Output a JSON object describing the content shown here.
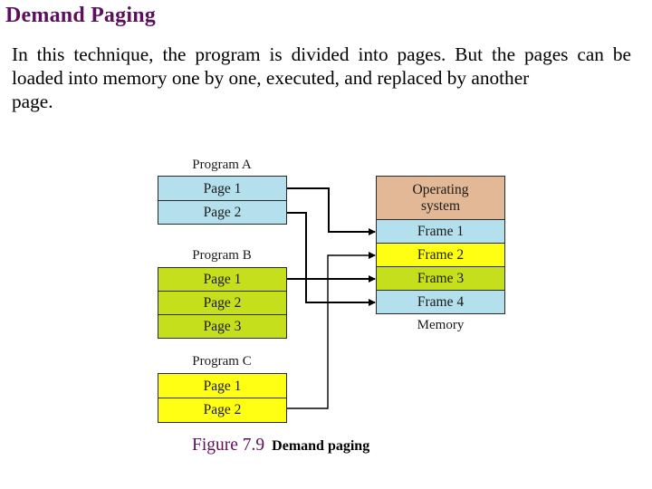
{
  "slide": {
    "title": "Demand Paging",
    "paragraph_main": "In this technique, the program is divided into pages. But the pages can be loaded into memory one by one, executed, and replaced by another",
    "paragraph_last": "page."
  },
  "colors": {
    "title": "#5c0f5c",
    "program_a": "#b3e0ec",
    "program_b": "#c5df1c",
    "program_c": "#ffff14",
    "operating_system": "#e3b896",
    "line": "#000000"
  },
  "diagram": {
    "programs": [
      {
        "name": "Program A",
        "pages": [
          "Page 1",
          "Page 2"
        ]
      },
      {
        "name": "Program B",
        "pages": [
          "Page 1",
          "Page 2",
          "Page 3"
        ]
      },
      {
        "name": "Program C",
        "pages": [
          "Page 1",
          "Page 2"
        ]
      }
    ],
    "memory": {
      "label": "Memory",
      "os_label": "Operating system",
      "frames": [
        "Frame 1",
        "Frame 2",
        "Frame 3",
        "Frame 4"
      ]
    },
    "mappings": [
      {
        "program": "Program A",
        "page": "Page 1",
        "frame": "Frame 1"
      },
      {
        "program": "Program C",
        "page": "Page 2",
        "frame": "Frame 2"
      },
      {
        "program": "Program B",
        "page": "Page 1",
        "frame": "Frame 3"
      },
      {
        "program": "Program A",
        "page": "Page 2",
        "frame": "Frame 4"
      }
    ]
  },
  "caption": {
    "number": "Figure 7.9",
    "text": "Demand paging"
  }
}
